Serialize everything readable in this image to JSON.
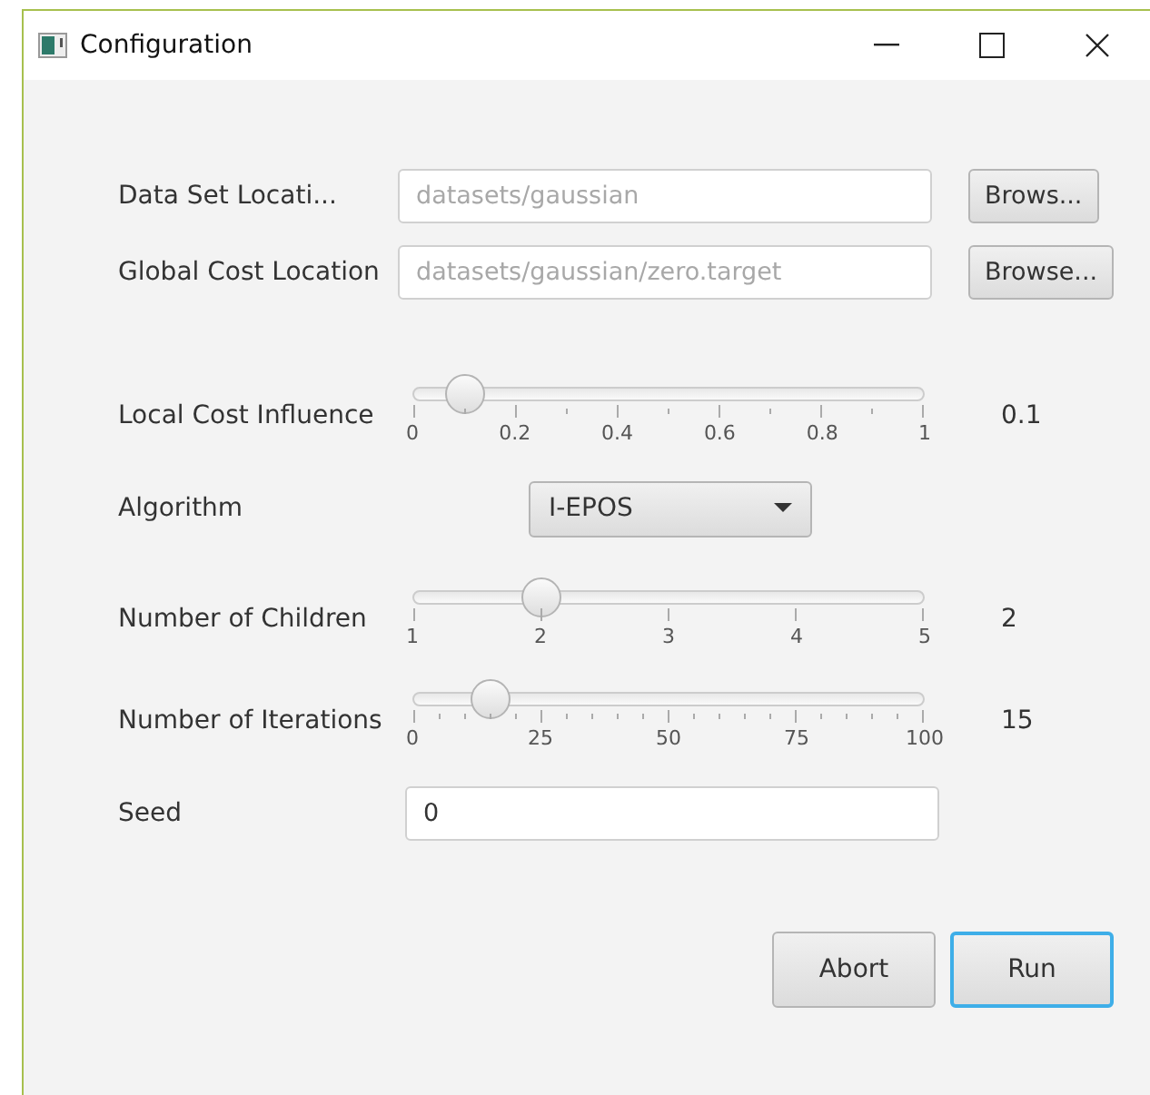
{
  "window": {
    "title": "Configuration"
  },
  "file_fields": [
    {
      "label": "Data Set Locati...",
      "placeholder": "datasets/gaussian",
      "button": "Brows..."
    },
    {
      "label": "Global Cost Location",
      "placeholder": "datasets/gaussian/zero.target",
      "button": "Browse..."
    }
  ],
  "settings": [
    {
      "kind": "slider",
      "label": "Local Cost Influence",
      "scale": [
        {
          "kind": "major",
          "label": "0"
        },
        {
          "kind": "minor"
        },
        {
          "kind": "major",
          "label": "0.2"
        },
        {
          "kind": "minor"
        },
        {
          "kind": "major",
          "label": "0.4"
        },
        {
          "kind": "minor"
        },
        {
          "kind": "major",
          "label": "0.6"
        },
        {
          "kind": "minor"
        },
        {
          "kind": "major",
          "label": "0.8"
        },
        {
          "kind": "minor"
        },
        {
          "kind": "major",
          "label": "1"
        }
      ],
      "level": 0.1,
      "reading": "0.1"
    },
    {
      "kind": "dropdown",
      "label": "Algorithm",
      "value": "I-EPOS"
    },
    {
      "kind": "slider",
      "label": "Number of Children",
      "scale": [
        {
          "kind": "major",
          "label": "1"
        },
        {
          "kind": "major",
          "label": "2"
        },
        {
          "kind": "major",
          "label": "3"
        },
        {
          "kind": "major",
          "label": "4"
        },
        {
          "kind": "major",
          "label": "5"
        }
      ],
      "level": 0.25,
      "reading": "2"
    },
    {
      "kind": "slider",
      "label": "Number of Iterations",
      "scale": [
        {
          "kind": "major",
          "label": "0"
        },
        {
          "kind": "minor"
        },
        {
          "kind": "minor"
        },
        {
          "kind": "minor"
        },
        {
          "kind": "minor"
        },
        {
          "kind": "major",
          "label": "25"
        },
        {
          "kind": "minor"
        },
        {
          "kind": "minor"
        },
        {
          "kind": "minor"
        },
        {
          "kind": "minor"
        },
        {
          "kind": "major",
          "label": "50"
        },
        {
          "kind": "minor"
        },
        {
          "kind": "minor"
        },
        {
          "kind": "minor"
        },
        {
          "kind": "minor"
        },
        {
          "kind": "major",
          "label": "75"
        },
        {
          "kind": "minor"
        },
        {
          "kind": "minor"
        },
        {
          "kind": "minor"
        },
        {
          "kind": "minor"
        },
        {
          "kind": "major",
          "label": "100"
        }
      ],
      "level": 0.15,
      "reading": "15"
    },
    {
      "kind": "text",
      "label": "Seed",
      "value": "0"
    }
  ],
  "buttons": [
    {
      "label": "Abort",
      "focused": false
    },
    {
      "label": "Run",
      "focused": true
    }
  ]
}
